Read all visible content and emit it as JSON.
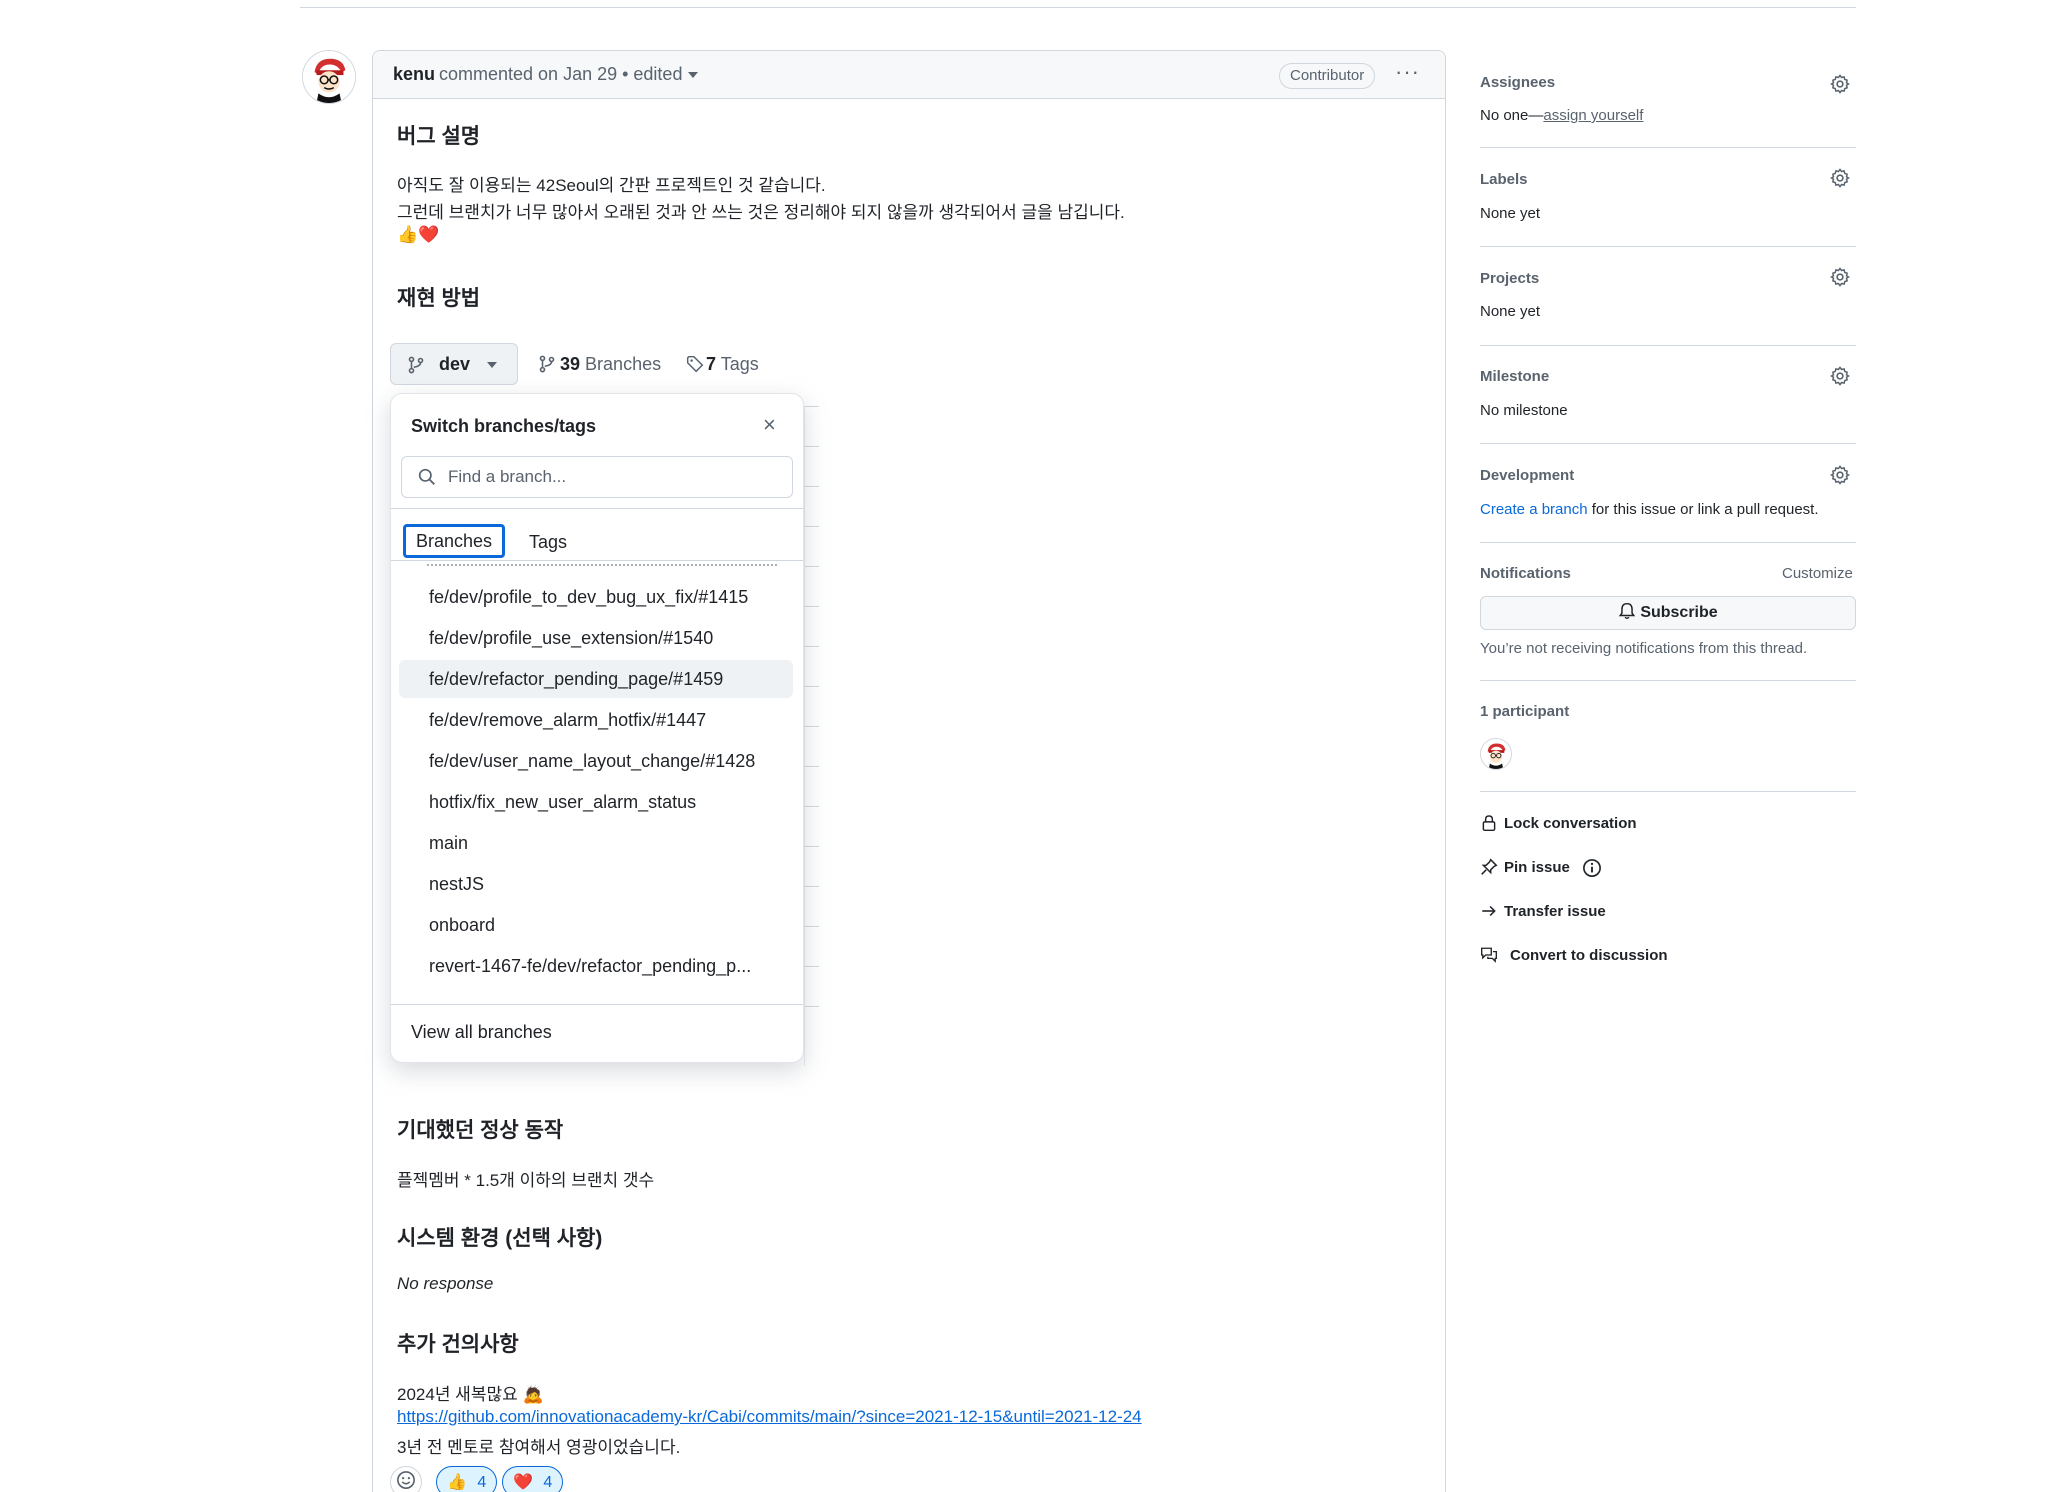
{
  "comment": {
    "author": "kenu",
    "meta_text": "commented on Jan 29 • edited",
    "role_badge": "Contributor",
    "more_label": "···",
    "body": {
      "bug_title": "버그 설명",
      "bug_line1": "아직도 잘 이용되는 42Seoul의 간판 프로젝트인 것 같습니다.",
      "bug_line2": "그런데 브랜치가 너무 많아서 오래된 것과 안 쓰는 것은 정리해야 되지 않을까 생각되어서 글을 남깁니다.",
      "bug_emoji": "👍❤️",
      "repro_title": "재현 방법",
      "expected_title": "기대했던 정상 동작",
      "expected_text": "플젝멤버 * 1.5개 이하의 브랜치 갯수",
      "env_title": "시스템 환경 (선택 사항)",
      "env_text": "No response",
      "extra_title": "추가 건의사항",
      "extra_line1": "2024년 새복많요 🙇",
      "extra_link": "https://github.com/innovationacademy-kr/Cabi/commits/main/?since=2021-12-15&until=2021-12-24",
      "extra_line3": "3년 전 멘토로 참여해서 영광이었습니다."
    },
    "screenshot": {
      "current_branch": "dev",
      "branches_count": "39",
      "branches_label": "Branches",
      "tags_count": "7",
      "tags_label": "Tags",
      "popover_title": "Switch branches/tags",
      "close_label": "×",
      "search_placeholder": "Find a branch...",
      "tab_branches": "Branches",
      "tab_tags": "Tags",
      "branches": [
        "fe/dev/profile_to_dev_bug_ux_fix/#1415",
        "fe/dev/profile_use_extension/#1540",
        "fe/dev/refactor_pending_page/#1459",
        "fe/dev/remove_alarm_hotfix/#1447",
        "fe/dev/user_name_layout_change/#1428",
        "hotfix/fix_new_user_alarm_status",
        "main",
        "nestJS",
        "onboard",
        "revert-1467-fe/dev/refactor_pending_p..."
      ],
      "highlighted_branch_index": 2,
      "view_all": "View all branches"
    },
    "reactions": {
      "add_reaction_icon": "smiley-icon",
      "thumbs_emoji": "👍",
      "thumbs_count": "4",
      "heart_emoji": "❤️",
      "heart_count": "4"
    }
  },
  "sidebar": {
    "assignees_title": "Assignees",
    "assignees_prefix": "No one—",
    "assignees_link": "assign yourself",
    "labels_title": "Labels",
    "labels_value": "None yet",
    "projects_title": "Projects",
    "projects_value": "None yet",
    "milestone_title": "Milestone",
    "milestone_value": "No milestone",
    "development_title": "Development",
    "development_link": "Create a branch",
    "development_suffix": " for this issue or link a pull request.",
    "notifications_title": "Notifications",
    "customize_label": "Customize",
    "subscribe_label": "Subscribe",
    "notifications_note": "You’re not receiving notifications from this thread.",
    "participants_title": "1 participant",
    "actions": {
      "lock": "Lock conversation",
      "pin": "Pin issue",
      "transfer": "Transfer issue",
      "convert": "Convert to discussion"
    }
  },
  "colors": {
    "accent": "#0969da",
    "border": "#d0d7de",
    "muted": "#59636e",
    "header_bg": "#f6f8fa"
  }
}
